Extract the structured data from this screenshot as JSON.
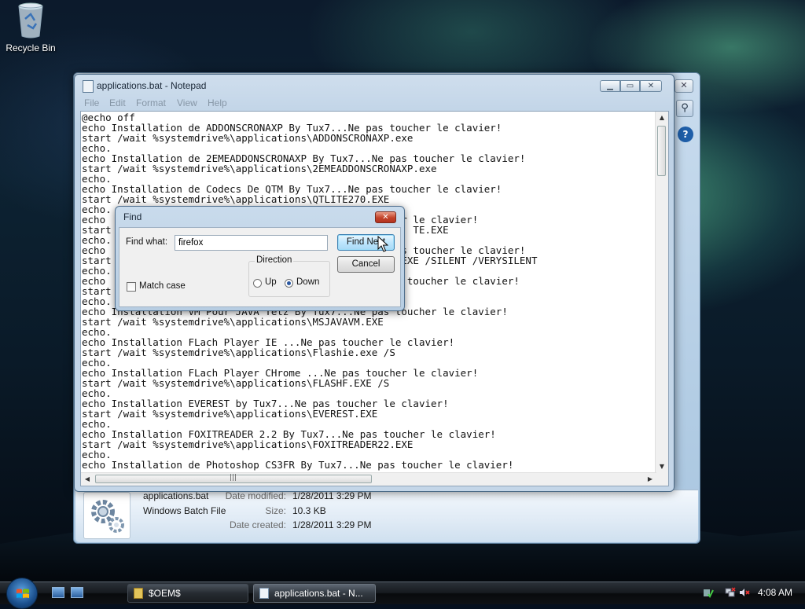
{
  "desktop": {
    "recycle_bin_label": "Recycle Bin"
  },
  "explorer": {
    "details": {
      "file_name": "applications.bat",
      "file_type": "Windows Batch File",
      "date_modified_label": "Date modified:",
      "date_modified": "1/28/2011 3:29 PM",
      "size_label": "Size:",
      "size": "10.3 KB",
      "date_created_label": "Date created:",
      "date_created": "1/28/2011 3:29 PM"
    }
  },
  "notepad": {
    "title": "applications.bat - Notepad",
    "menu": [
      "File",
      "Edit",
      "Format",
      "View",
      "Help"
    ],
    "lines": [
      "@echo off",
      "echo Installation de ADDONSCRONAXP By Tux7...Ne pas toucher le clavier!",
      "start /wait %systemdrive%\\applications\\ADDONSCRONAXP.exe",
      "echo.",
      "echo Installation de 2EMEADDONSCRONAXP By Tux7...Ne pas toucher le clavier!",
      "start /wait %systemdrive%\\applications\\2EMEADDONSCRONAXP.exe",
      "echo.",
      "echo Installation de Codecs De QTM By Tux7...Ne pas toucher le clavier!",
      "start /wait %systemdrive%\\applications\\QTLITE270.EXE",
      "echo.",
      "echo                                        pas toucher le clavier!",
      "start                                                   TE.EXE",
      "echo.",
      "echo                                                  s toucher le clavier!",
      "start                                             -21.EXE /SILENT /VERYSILENT",
      "echo.",
      "echo                                                 s toucher le clavier!",
      "start",
      "echo.",
      "echo Installation VM Pour JAVA Tetz By Tux7...Ne pas toucher le clavier!",
      "start /wait %systemdrive%\\applications\\MSJAVAVM.EXE",
      "echo.",
      "echo Installation FLach Player IE ...Ne pas toucher le clavier!",
      "start /wait %systemdrive%\\applications\\Flashie.exe /S",
      "echo.",
      "echo Installation FLach Player CHrome ...Ne pas toucher le clavier!",
      "start /wait %systemdrive%\\applications\\FLASHF.EXE /S",
      "echo.",
      "echo Installation EVEREST by Tux7...Ne pas toucher le clavier!",
      "start /wait %systemdrive%\\applications\\EVEREST.EXE",
      "echo.",
      "echo Installation FOXITREADER 2.2 By Tux7...Ne pas toucher le clavier!",
      "start /wait %systemdrive%\\applications\\FOXITREADER22.EXE",
      "echo.",
      "echo Installation de Photoshop CS3FR By Tux7...Ne pas toucher le clavier!"
    ]
  },
  "find_dialog": {
    "title": "Find",
    "find_what_label": "Find what:",
    "find_what_value": "firefox",
    "find_next_label": "Find Next",
    "cancel_label": "Cancel",
    "direction_label": "Direction",
    "up_label": "Up",
    "down_label": "Down",
    "direction_selected": "Down",
    "match_case_label": "Match case",
    "match_case_checked": false
  },
  "taskbar": {
    "buttons": [
      {
        "label": "$OEM$",
        "active": false
      },
      {
        "label": "applications.bat - N...",
        "active": true
      }
    ],
    "clock": "4:08 AM"
  }
}
